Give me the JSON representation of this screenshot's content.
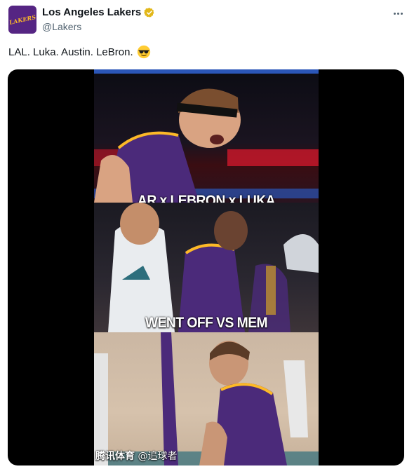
{
  "author": {
    "display_name": "Los Angeles Lakers",
    "handle": "@Lakers",
    "avatar_text": "LAKERS",
    "verified": true
  },
  "tweet": {
    "text": "LAL. Luka. Austin. LeBron.",
    "emoji": "sunglasses-emoji"
  },
  "video": {
    "caption_top": "AR x LEBRON x LUKA",
    "caption_mid": "WENT OFF VS MEM"
  },
  "watermark": {
    "brand": "腾讯体育",
    "credit": "@追球者"
  },
  "colors": {
    "brand_purple": "#552583",
    "brand_gold": "#fdb927",
    "verified_gold": "#e2b719",
    "text_primary": "#0f1419",
    "text_secondary": "#536471"
  }
}
